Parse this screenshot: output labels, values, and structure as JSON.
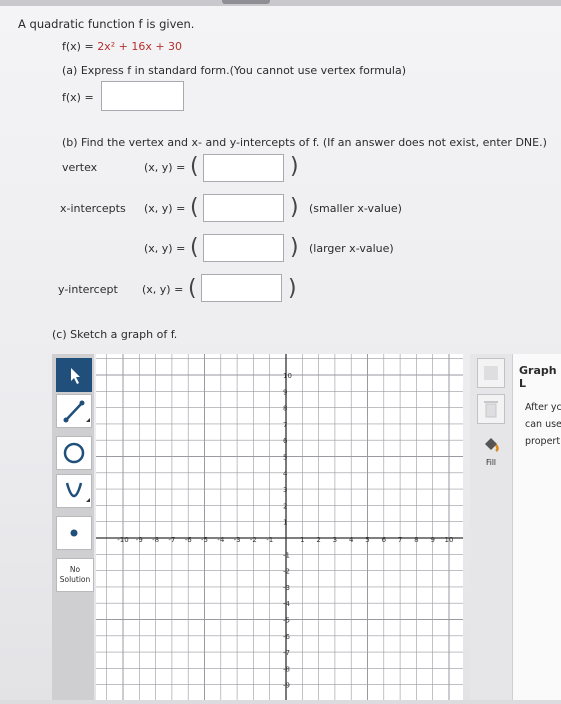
{
  "question": {
    "intro": "A quadratic function f is given.",
    "function_lhs": "f(x) = ",
    "function_rhs": "2x² + 16x + 30",
    "part_a": "(a) Express f in standard form.(You cannot use vertex formula)",
    "part_a_label": "f(x) =",
    "part_b": "(b) Find the vertex and x- and y-intercepts of f. (If an answer does not exist, enter DNE.)",
    "rows": [
      {
        "label": "vertex",
        "eq": "(x, y) =",
        "note": ""
      },
      {
        "label": "x-intercepts",
        "eq": "(x, y) =",
        "note": "(smaller x-value)"
      },
      {
        "label": "",
        "eq": "(x, y) =",
        "note": "(larger x-value)"
      },
      {
        "label": "y-intercept",
        "eq": "(x, y) =",
        "note": ""
      }
    ],
    "part_c": "(c) Sketch a graph of f."
  },
  "tools": {
    "no_solution_line1": "No",
    "no_solution_line2": "Solution",
    "fill_label": "Fill"
  },
  "legend": {
    "title": "Graph L",
    "lines": [
      "After yc",
      "can use",
      "propert"
    ]
  },
  "graph": {
    "x_tick_labels": [
      "-10",
      "-9",
      "-8",
      "-7",
      "-6",
      "-5",
      "-4",
      "-3",
      "-2",
      "-1",
      "1",
      "2",
      "3",
      "4",
      "5",
      "6",
      "7",
      "8",
      "9",
      "10"
    ],
    "y_tick_labels_pos": [
      "10",
      "9",
      "8",
      "7",
      "6",
      "5",
      "4",
      "3",
      "2",
      "1"
    ],
    "y_tick_labels_neg": [
      "-1",
      "-2",
      "-3",
      "-4",
      "-5",
      "-6",
      "-7",
      "-8",
      "-9"
    ]
  }
}
